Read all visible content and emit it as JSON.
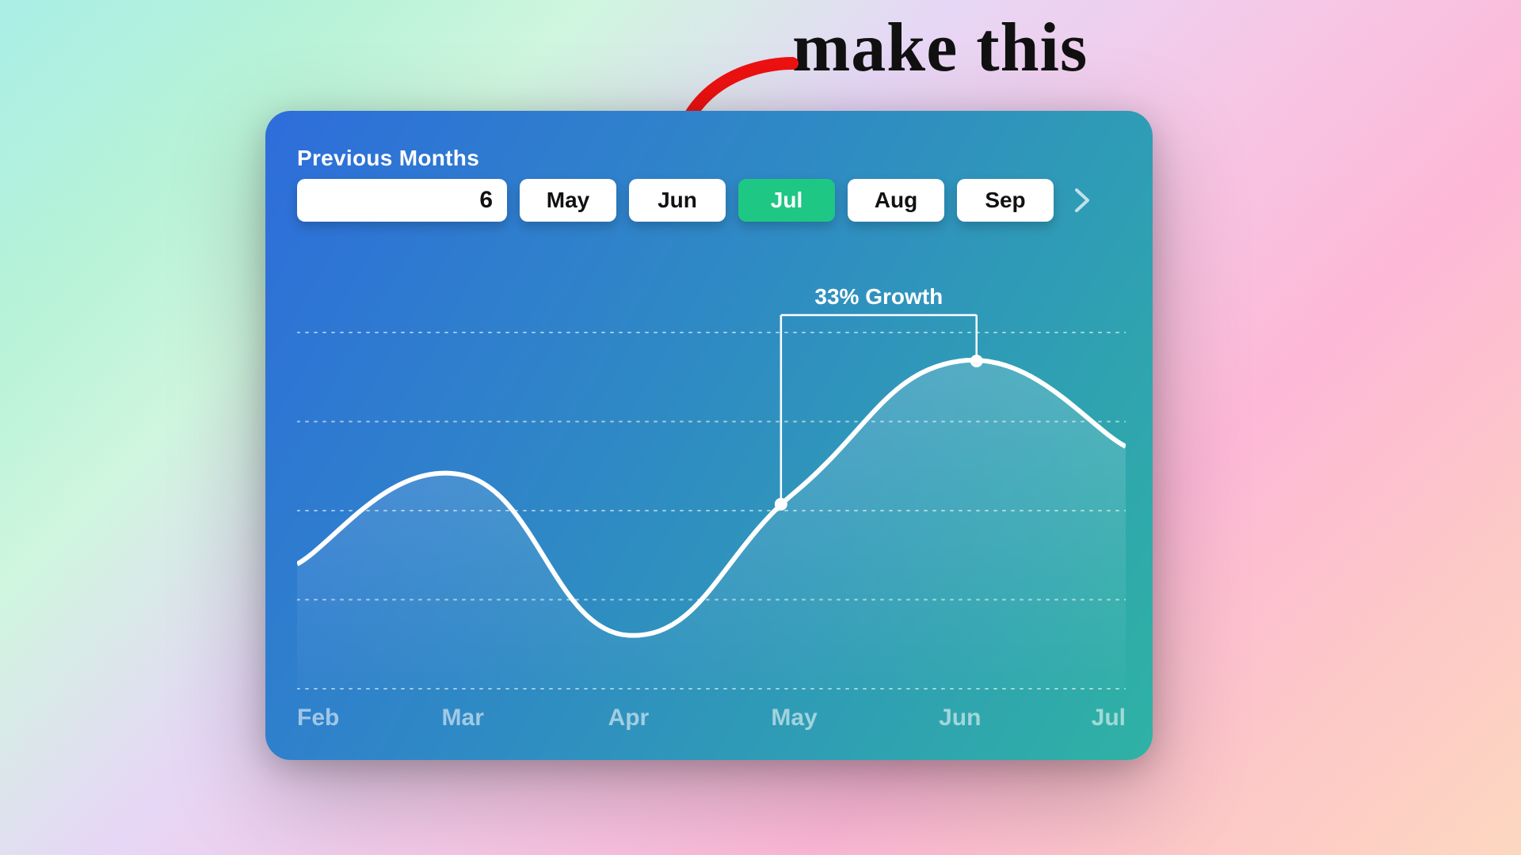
{
  "handwritten_label": "make this",
  "card": {
    "previous_months_label": "Previous Months",
    "previous_months_value": "6",
    "months": [
      "May",
      "Jun",
      "Jul",
      "Aug",
      "Sep"
    ],
    "selected_month_index": 2,
    "growth_label": "33% Growth"
  },
  "chart_data": {
    "type": "area",
    "title": "",
    "xlabel": "",
    "ylabel": "",
    "ylim": [
      0,
      100
    ],
    "categories": [
      "Feb",
      "Mar",
      "Apr",
      "May",
      "Jun",
      "Jul"
    ],
    "values": [
      35,
      60,
      15,
      55,
      92,
      68
    ],
    "annotation": {
      "from_category": "May",
      "to_category": "Jun",
      "label": "33% Growth",
      "percent": 33
    },
    "grid": {
      "y_lines": 5
    }
  }
}
